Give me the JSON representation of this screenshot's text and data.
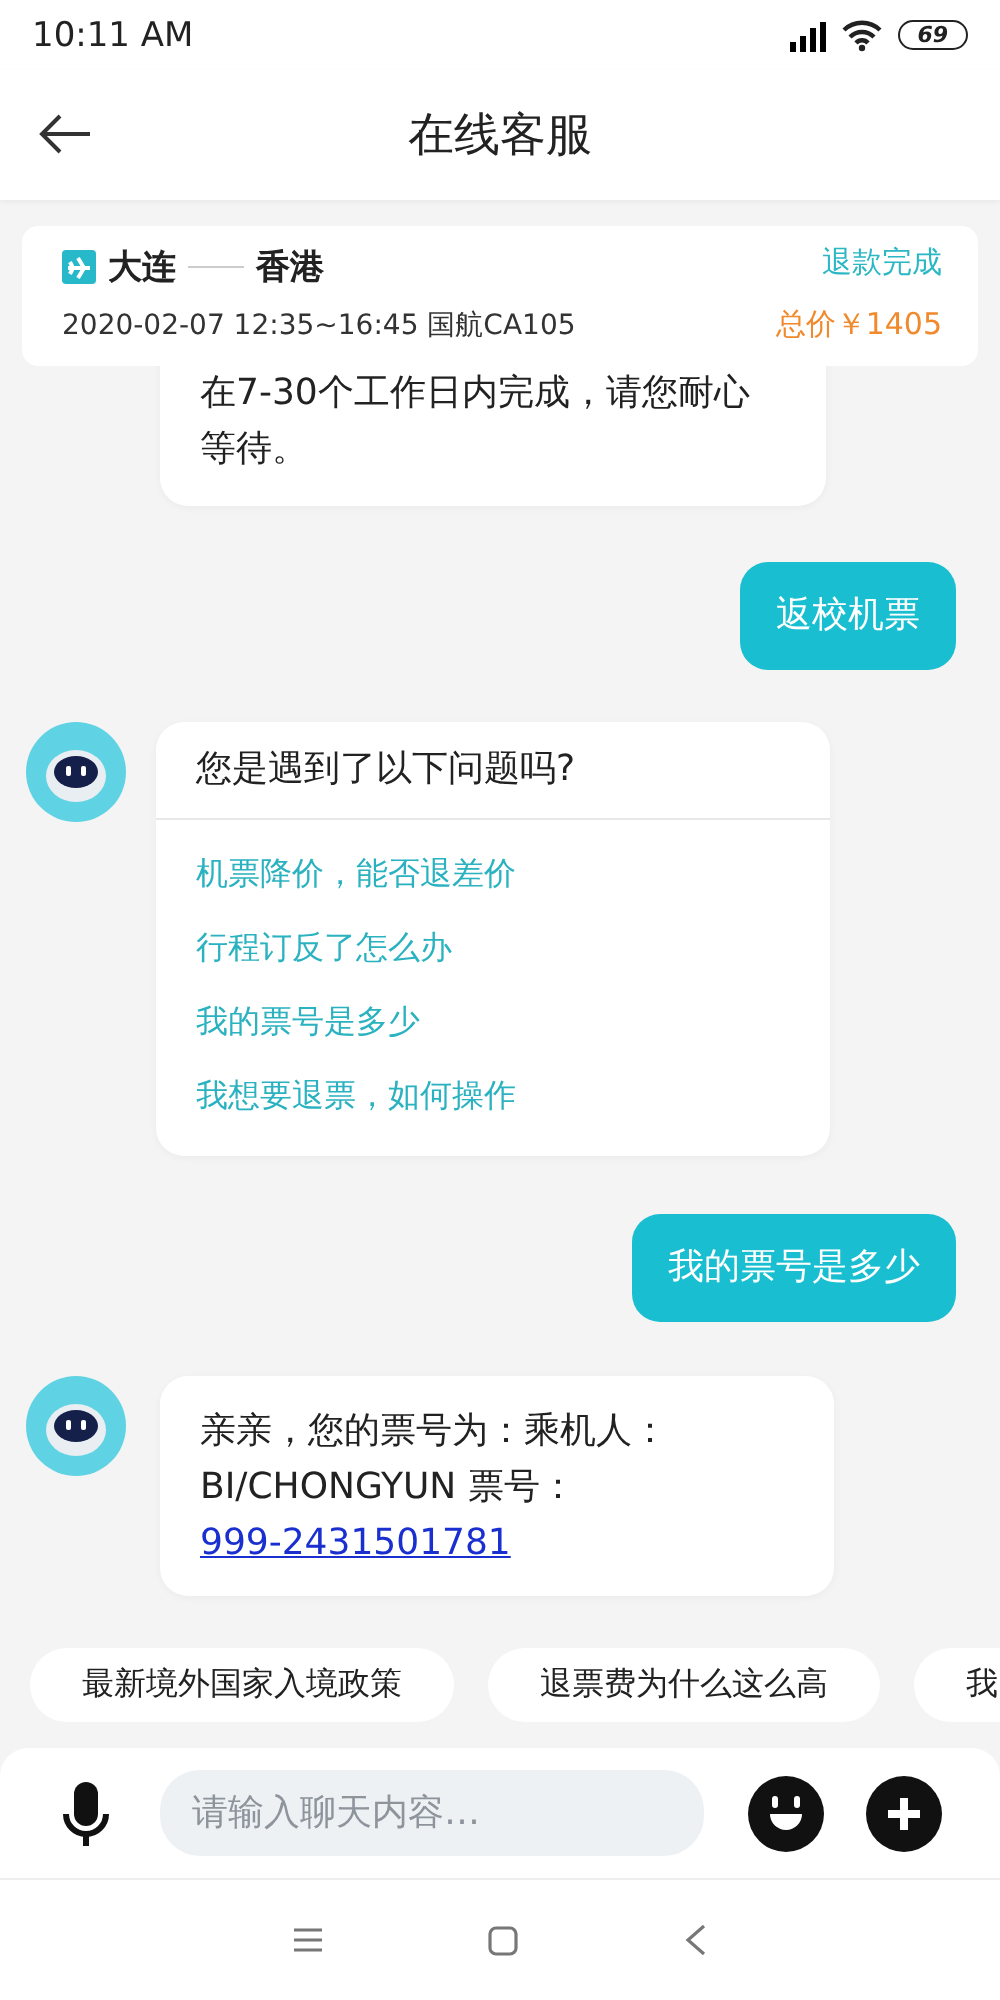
{
  "status_bar": {
    "time": "10:11  AM",
    "battery": "69"
  },
  "header": {
    "title": "在线客服"
  },
  "trip": {
    "from": "大连",
    "to": "香港",
    "details": "2020-02-07 12:35~16:45  国航CA105",
    "status": "退款完成",
    "price": "总价￥1405"
  },
  "messages": [
    {
      "kind": "bot_cut",
      "text": "在7-30个工作日内完成，请您耐心等待。"
    },
    {
      "kind": "user",
      "text": "返校机票"
    },
    {
      "kind": "bot_menu",
      "question": "您是遇到了以下问题吗?",
      "options": [
        "机票降价，能否退差价",
        "行程订反了怎么办",
        "我的票号是多少",
        "我想要退票，如何操作"
      ]
    },
    {
      "kind": "user",
      "text": "我的票号是多少"
    },
    {
      "kind": "bot_text",
      "text": "亲亲，您的票号为：乘机人：BI/CHONGYUN 票号：",
      "link": "999-2431501781"
    }
  ],
  "quick_replies": [
    "最新境外国家入境政策",
    "退票费为什么这么高",
    "我"
  ],
  "composer": {
    "placeholder": "请输入聊天内容…"
  }
}
